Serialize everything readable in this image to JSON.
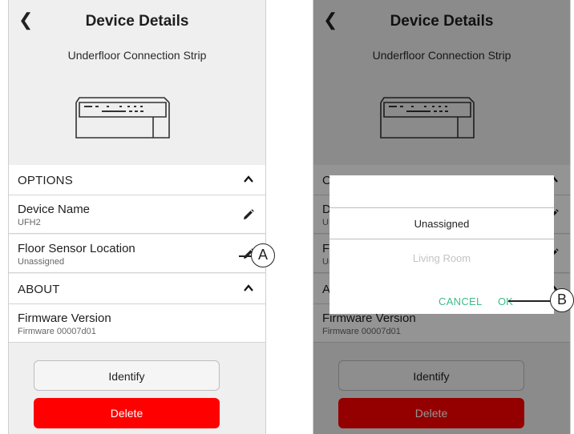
{
  "header": {
    "title": "Device Details",
    "subtitle": "Underfloor Connection Strip"
  },
  "options": {
    "label": "OPTIONS",
    "device_name": {
      "label": "Device Name",
      "value": "UFH2"
    },
    "floor_sensor": {
      "label": "Floor Sensor Location",
      "value": "Unassigned"
    }
  },
  "about": {
    "label": "ABOUT",
    "firmware": {
      "label": "Firmware Version",
      "value": "Firmware 00007d01"
    }
  },
  "buttons": {
    "identify": "Identify",
    "delete": "Delete"
  },
  "dialog": {
    "options": [
      "Unassigned",
      "Living Room"
    ],
    "cancel": "CANCEL",
    "ok": "OK"
  },
  "callouts": {
    "a": "A",
    "b": "B"
  },
  "colors": {
    "accent": "#3dbc8a",
    "delete": "#ff0000"
  }
}
